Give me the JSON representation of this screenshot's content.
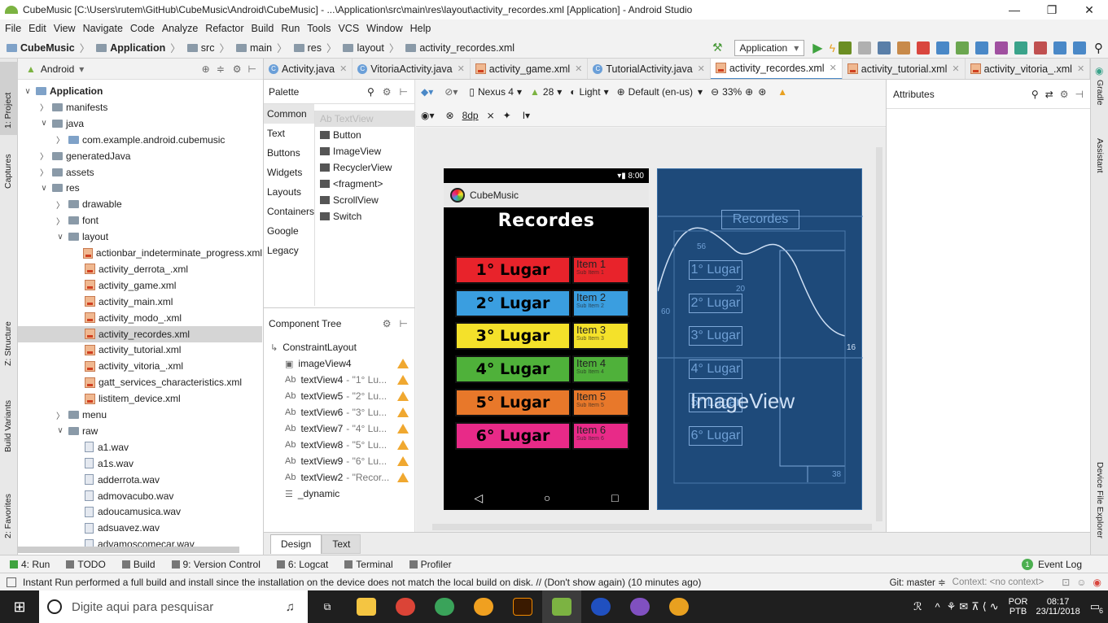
{
  "window": {
    "title": "CubeMusic [C:\\Users\\rutem\\GitHub\\CubeMusic\\Android\\CubeMusic] - ...\\Application\\src\\main\\res\\layout\\activity_recordes.xml [Application] - Android Studio",
    "min": "—",
    "max": "❐",
    "close": "✕"
  },
  "menu": [
    "File",
    "Edit",
    "View",
    "Navigate",
    "Code",
    "Analyze",
    "Refactor",
    "Build",
    "Run",
    "Tools",
    "VCS",
    "Window",
    "Help"
  ],
  "breadcrumbs": [
    "CubeMusic",
    "Application",
    "src",
    "main",
    "res",
    "layout",
    "activity_recordes.xml"
  ],
  "run_config": "Application",
  "left_strip": {
    "project": "1: Project",
    "captures": "Captures",
    "structure": "Z: Structure",
    "build_variants": "Build Variants",
    "favorites": "2: Favorites"
  },
  "right_strip": {
    "gradle": "Gradle",
    "assistant": "Assistant",
    "device_explorer": "Device File Explorer"
  },
  "project_panel": {
    "view": "Android",
    "items": [
      {
        "label": "Application",
        "depth": 0,
        "arrow": "v",
        "type": "module"
      },
      {
        "label": "manifests",
        "depth": 1,
        "arrow": ">",
        "type": "folder"
      },
      {
        "label": "java",
        "depth": 1,
        "arrow": "v",
        "type": "folder"
      },
      {
        "label": "com.example.android.cubemusic",
        "depth": 2,
        "arrow": ">",
        "type": "pkg"
      },
      {
        "label": "generatedJava",
        "depth": 1,
        "arrow": ">",
        "type": "folder"
      },
      {
        "label": "assets",
        "depth": 1,
        "arrow": ">",
        "type": "folder"
      },
      {
        "label": "res",
        "depth": 1,
        "arrow": "v",
        "type": "folder"
      },
      {
        "label": "drawable",
        "depth": 2,
        "arrow": ">",
        "type": "folder"
      },
      {
        "label": "font",
        "depth": 2,
        "arrow": ">",
        "type": "folder"
      },
      {
        "label": "layout",
        "depth": 2,
        "arrow": "v",
        "type": "folder"
      },
      {
        "label": "actionbar_indeterminate_progress.xml",
        "depth": 3,
        "arrow": "",
        "type": "xml"
      },
      {
        "label": "activity_derrota_.xml",
        "depth": 3,
        "arrow": "",
        "type": "xml"
      },
      {
        "label": "activity_game.xml",
        "depth": 3,
        "arrow": "",
        "type": "xml"
      },
      {
        "label": "activity_main.xml",
        "depth": 3,
        "arrow": "",
        "type": "xml"
      },
      {
        "label": "activity_modo_.xml",
        "depth": 3,
        "arrow": "",
        "type": "xml"
      },
      {
        "label": "activity_recordes.xml",
        "depth": 3,
        "arrow": "",
        "type": "xml",
        "selected": true
      },
      {
        "label": "activity_tutorial.xml",
        "depth": 3,
        "arrow": "",
        "type": "xml"
      },
      {
        "label": "activity_vitoria_.xml",
        "depth": 3,
        "arrow": "",
        "type": "xml"
      },
      {
        "label": "gatt_services_characteristics.xml",
        "depth": 3,
        "arrow": "",
        "type": "xml"
      },
      {
        "label": "listitem_device.xml",
        "depth": 3,
        "arrow": "",
        "type": "xml"
      },
      {
        "label": "menu",
        "depth": 2,
        "arrow": ">",
        "type": "folder"
      },
      {
        "label": "raw",
        "depth": 2,
        "arrow": "v",
        "type": "folder"
      },
      {
        "label": "a1.wav",
        "depth": 3,
        "arrow": "",
        "type": "wav"
      },
      {
        "label": "a1s.wav",
        "depth": 3,
        "arrow": "",
        "type": "wav"
      },
      {
        "label": "adderrota.wav",
        "depth": 3,
        "arrow": "",
        "type": "wav"
      },
      {
        "label": "admovacubo.wav",
        "depth": 3,
        "arrow": "",
        "type": "wav"
      },
      {
        "label": "adoucamusica.wav",
        "depth": 3,
        "arrow": "",
        "type": "wav"
      },
      {
        "label": "adsuavez.wav",
        "depth": 3,
        "arrow": "",
        "type": "wav"
      },
      {
        "label": "advamoscomecar.wav",
        "depth": 3,
        "arrow": "",
        "type": "wav"
      }
    ]
  },
  "editor_tabs": [
    {
      "label": "Activity.java",
      "icon": "java"
    },
    {
      "label": "VitoriaActivity.java",
      "icon": "java"
    },
    {
      "label": "activity_game.xml",
      "icon": "xml"
    },
    {
      "label": "TutorialActivity.java",
      "icon": "java"
    },
    {
      "label": "activity_recordes.xml",
      "icon": "xml",
      "active": true
    },
    {
      "label": "activity_tutorial.xml",
      "icon": "xml"
    },
    {
      "label": "activity_vitoria_.xml",
      "icon": "xml"
    }
  ],
  "tabs_overflow": "▾≡₃",
  "palette": {
    "title": "Palette",
    "categories": [
      "Common",
      "Text",
      "Buttons",
      "Widgets",
      "Layouts",
      "Containers",
      "Google",
      "Legacy"
    ],
    "items": [
      "Ab TextView",
      "Button",
      "ImageView",
      "RecyclerView",
      "<fragment>",
      "ScrollView",
      "Switch"
    ]
  },
  "component_tree": {
    "title": "Component Tree",
    "items": [
      {
        "label": "ConstraintLayout",
        "sub": "",
        "prefix": "",
        "warn": false,
        "depth": 0
      },
      {
        "label": "imageView4",
        "sub": "",
        "prefix": "img",
        "warn": true,
        "depth": 1
      },
      {
        "label": "textView4",
        "sub": "- \"1° Lu...",
        "prefix": "Ab",
        "warn": true,
        "depth": 1
      },
      {
        "label": "textView5",
        "sub": "- \"2° Lu...",
        "prefix": "Ab",
        "warn": true,
        "depth": 1
      },
      {
        "label": "textView6",
        "sub": "- \"3° Lu...",
        "prefix": "Ab",
        "warn": true,
        "depth": 1
      },
      {
        "label": "textView7",
        "sub": "- \"4° Lu...",
        "prefix": "Ab",
        "warn": true,
        "depth": 1
      },
      {
        "label": "textView8",
        "sub": "- \"5° Lu...",
        "prefix": "Ab",
        "warn": true,
        "depth": 1
      },
      {
        "label": "textView9",
        "sub": "- \"6° Lu...",
        "prefix": "Ab",
        "warn": true,
        "depth": 1
      },
      {
        "label": "textView2",
        "sub": "- \"Recor...",
        "prefix": "Ab",
        "warn": true,
        "depth": 1
      },
      {
        "label": "_dynamic",
        "sub": "",
        "prefix": "list",
        "warn": false,
        "depth": 1
      }
    ]
  },
  "design_toolbar": {
    "device": "Nexus 4",
    "api": "28",
    "theme": "Light",
    "locale": "Default (en-us)",
    "zoom": "33%",
    "margin": "8dp"
  },
  "attributes_title": "Attributes",
  "phone": {
    "time": "8:00",
    "app_name": "CubeMusic",
    "title": "Recordes",
    "ranks": [
      {
        "place": "1° Lugar",
        "item": "Item 1",
        "sub": "Sub Item 1",
        "color": "#e8232b"
      },
      {
        "place": "2° Lugar",
        "item": "Item 2",
        "sub": "Sub Item 2",
        "color": "#3a9ee0"
      },
      {
        "place": "3° Lugar",
        "item": "Item 3",
        "sub": "Sub Item 3",
        "color": "#f4e12a"
      },
      {
        "place": "4° Lugar",
        "item": "Item 4",
        "sub": "Sub Item 4",
        "color": "#4fb13a"
      },
      {
        "place": "5° Lugar",
        "item": "Item 5",
        "sub": "Sub Item 5",
        "color": "#e8782a"
      },
      {
        "place": "6° Lugar",
        "item": "Item 6",
        "sub": "Sub Item 6",
        "color": "#e82a88"
      }
    ]
  },
  "blueprint": {
    "title": "Recordes",
    "image_label": "ImageView",
    "places": [
      "1° Lugar",
      "2° Lugar",
      "3° Lugar",
      "4° Lugar",
      "5° Lugar",
      "6° Lugar"
    ],
    "dims": {
      "a": "60",
      "b": "20",
      "c": "16",
      "d": "38",
      "e": "56"
    }
  },
  "design_tabs": [
    "Design",
    "Text"
  ],
  "bottom_tools": [
    "4: Run",
    "TODO",
    "Build",
    "9: Version Control",
    "6: Logcat",
    "Terminal",
    "Profiler"
  ],
  "event_log": "Event Log",
  "event_log_count": "1",
  "status": {
    "message": "Instant Run performed a full build and install since the installation on the device does not match the local build on disk. // (Don't show again) (10 minutes ago)",
    "git": "Git: master ≑",
    "context": "Context: <no context>"
  },
  "taskbar": {
    "search": "Digite aqui para pesquisar",
    "lang1": "POR",
    "lang2": "PTB",
    "time": "08:17",
    "date": "23/11/2018",
    "notif_count": "6"
  }
}
